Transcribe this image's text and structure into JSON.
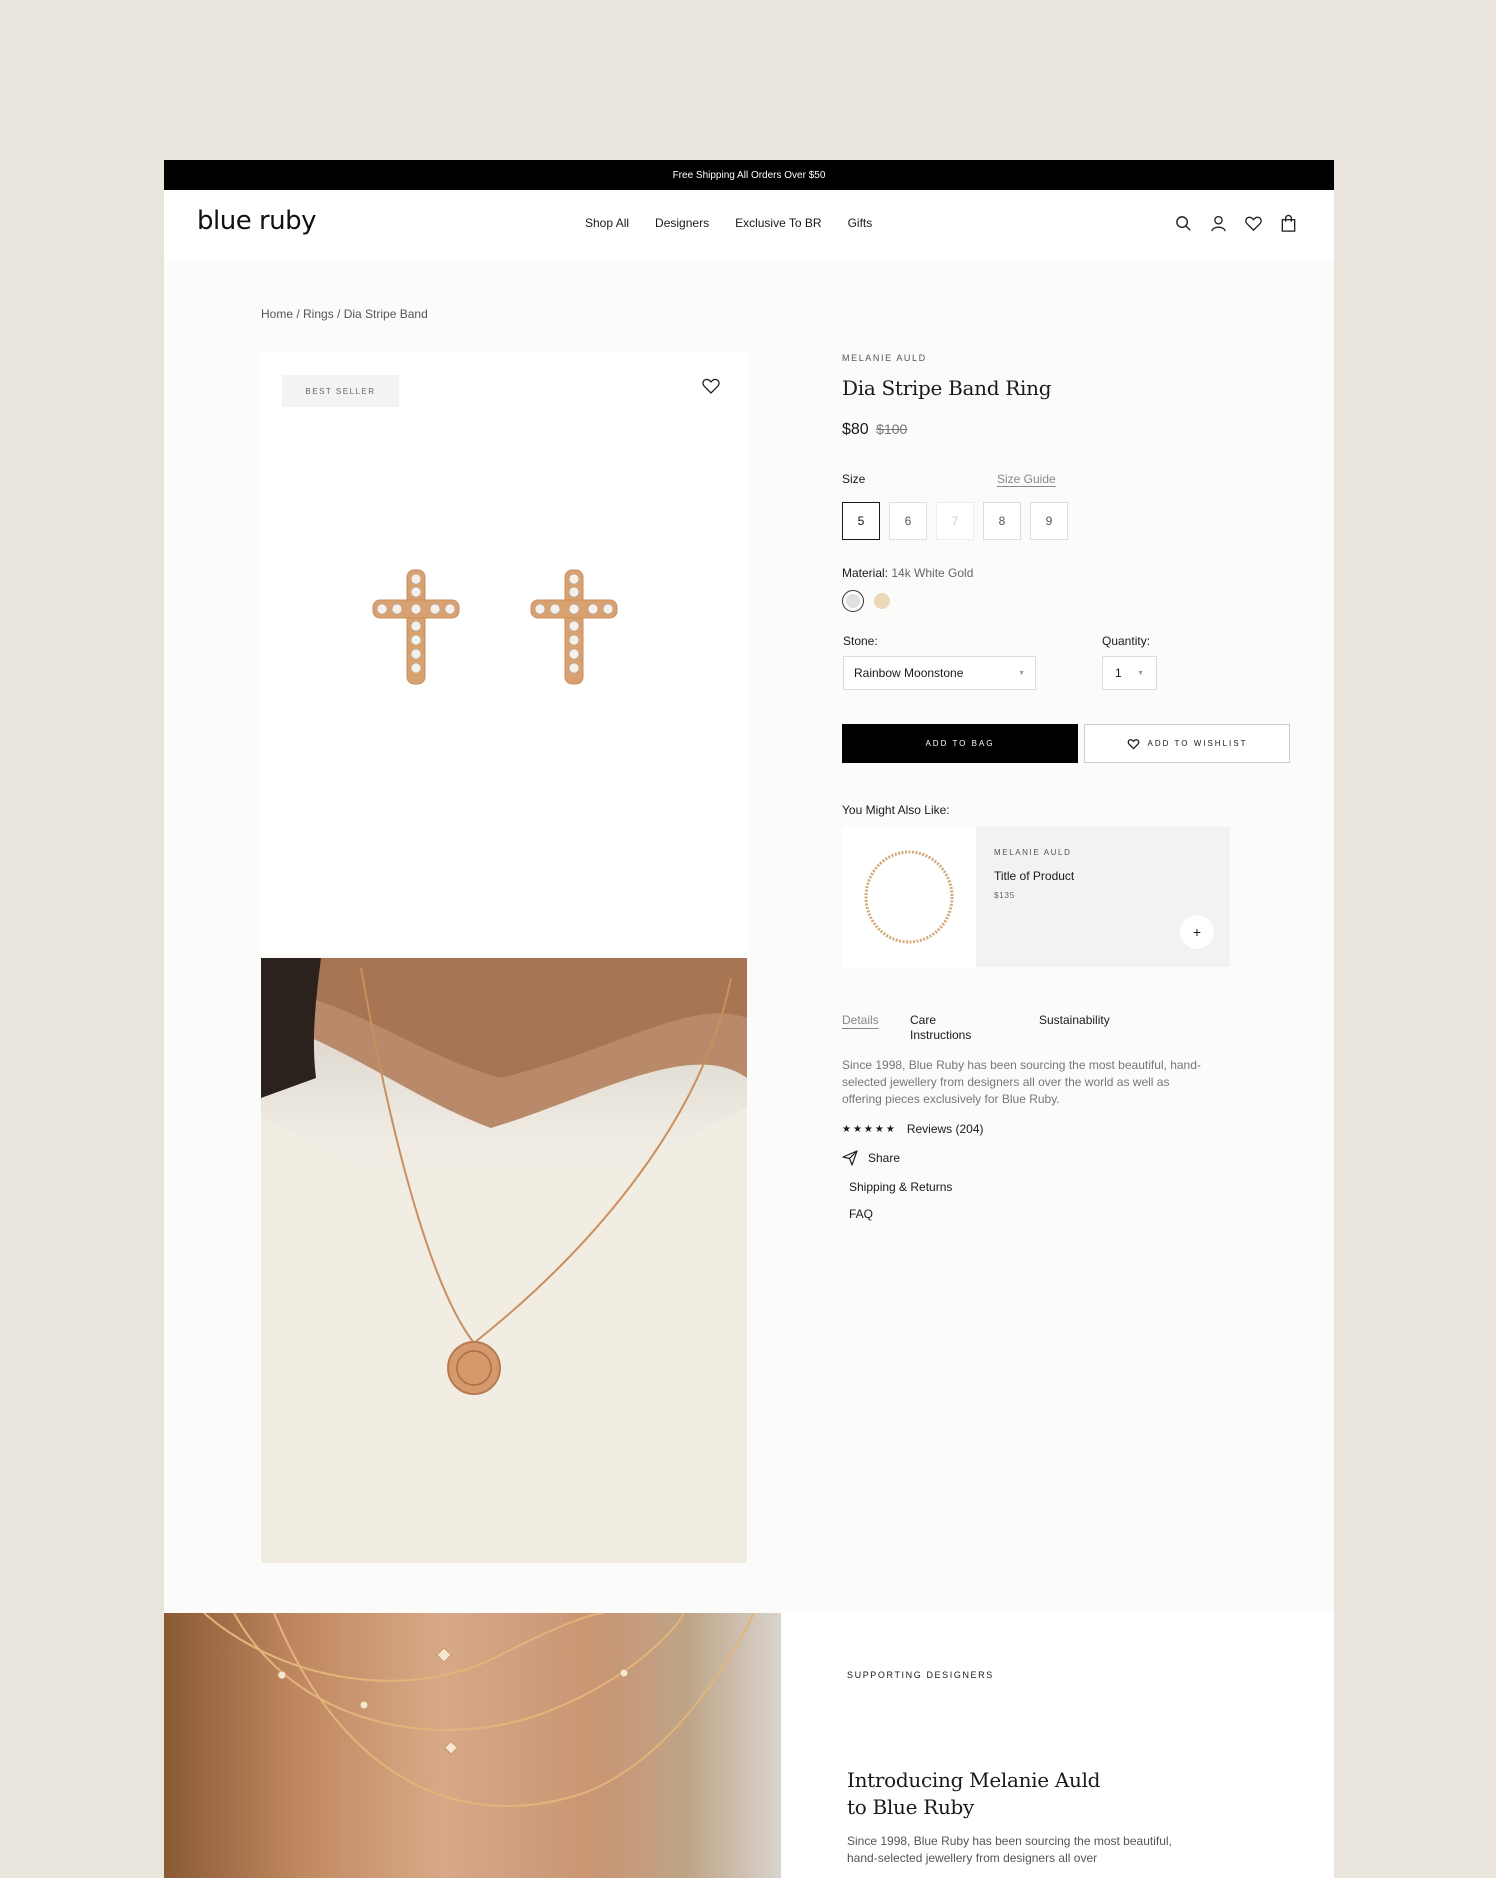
{
  "promo": "Free Shipping All Orders Over $50",
  "logo": "blue ruby",
  "nav": [
    "Shop All",
    "Designers",
    "Exclusive To BR",
    "Gifts"
  ],
  "header_icons": [
    "search-icon",
    "account-icon",
    "wishlist-icon",
    "bag-icon"
  ],
  "breadcrumb": "Home / Rings / Dia Stripe Band",
  "gallery": {
    "badge": "BEST SELLER"
  },
  "product": {
    "brand": "MELANIE AULD",
    "title": "Dia Stripe Band Ring",
    "price": "$80",
    "old_price": "$100",
    "size_label": "Size",
    "size_guide": "Size Guide",
    "sizes": [
      "5",
      "6",
      "7",
      "8",
      "9"
    ],
    "selected_size": "5",
    "disabled_size": "7",
    "material_label": "Material:",
    "material_value": "14k White Gold",
    "material_swatches": [
      "#dfdfdd",
      "#ead8b6"
    ],
    "stone_label": "Stone:",
    "stone_value": "Rainbow Moonstone",
    "quantity_label": "Quantity:",
    "quantity_value": "1",
    "add_to_bag": "ADD TO BAG",
    "add_to_wishlist": "ADD TO WISHLIST"
  },
  "also": {
    "label": "You Might Also Like:",
    "brand": "MELANIE AULD",
    "title": "Title of Product",
    "price": "$135",
    "add": "+"
  },
  "tabs": [
    "Details",
    "Care Instructions",
    "Sustainability"
  ],
  "details_text": "Since 1998, Blue Ruby has been sourcing the most beautiful, hand-selected jewellery from designers all over the world as well as offering pieces exclusively for Blue Ruby.",
  "reviews": {
    "stars": "★★★★★",
    "label": "Reviews (204)"
  },
  "share": "Share",
  "links": [
    "Shipping & Returns",
    "FAQ"
  ],
  "lower": {
    "kicker": "SUPPORTING DESIGNERS",
    "title_line1": "Introducing Melanie Auld",
    "title_line2": "to Blue Ruby",
    "body": "Since 1998, Blue Ruby has been sourcing the most beautiful, hand-selected jewellery from designers all over"
  },
  "colors": {
    "accent": "#000000",
    "page_bg": "#e9e5dc",
    "frame_bg": "#fbfbfa",
    "gold": "#d9a16f"
  }
}
